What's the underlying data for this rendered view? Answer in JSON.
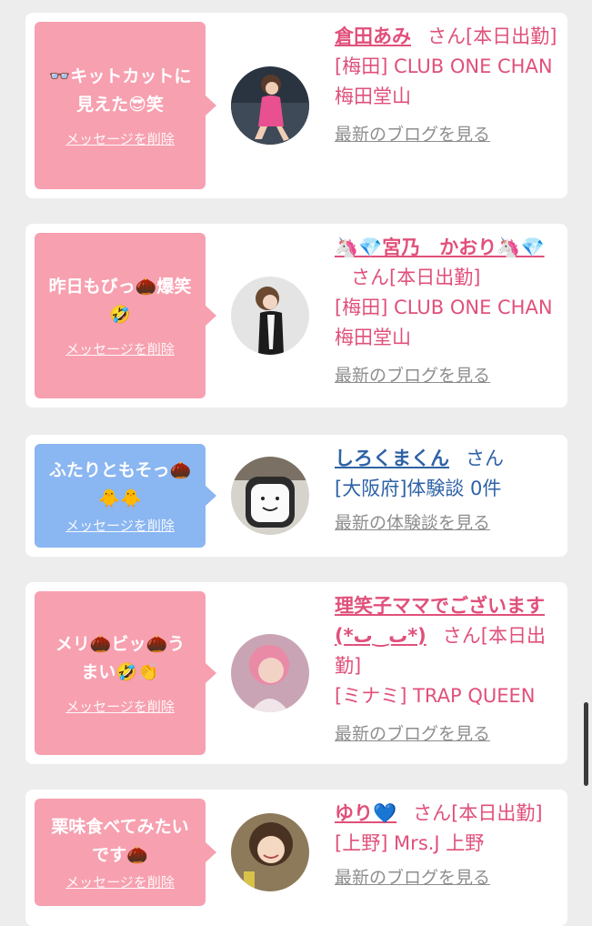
{
  "cards": [
    {
      "message": "👓キットカットに\n見えた😎笑",
      "delete_label": "メッセージを削除",
      "name": "倉田あみ",
      "suffix": "さん[本日出勤]",
      "detail": "[梅田] CLUB ONE CHAN 梅田堂山",
      "link": "最新のブログを見る",
      "bubble_color": "#f7a0b0",
      "avatar": "woman-pink-dress-avatar"
    },
    {
      "message": "昨日もびっ🌰爆笑\n🤣",
      "delete_label": "メッセージを削除",
      "name": "🦄💎宮乃　かおり🦄💎",
      "suffix": "さん[本日出勤]",
      "detail": "[梅田] CLUB ONE CHAN 梅田堂山",
      "link": "最新のブログを見る",
      "bubble_color": "#f7a0b0",
      "avatar": "woman-black-dress-avatar"
    },
    {
      "message": "ふたりともそっ🌰\n🐥🐥",
      "delete_label": "メッセージを削除",
      "name": "しろくまくん",
      "suffix": "さん",
      "detail": "[大阪府]体験談 0件",
      "link": "最新の体験談を見る",
      "bubble_color": "#8ab6f1",
      "avatar": "toast-character-avatar"
    },
    {
      "message": "メリ🌰ビッ🌰う\nまい🤣👏",
      "delete_label": "メッセージを削除",
      "name": "理笑子ママでございます(*ٮ‿ٮ*)",
      "suffix": "さん[本日出勤]",
      "detail": "[ミナミ] TRAP QUEEN",
      "link": "最新のブログを見る",
      "bubble_color": "#f7a0b0",
      "avatar": "woman-pink-hair-avatar"
    },
    {
      "message": "栗味食べてみたい\nです🌰",
      "delete_label": "メッセージを削除",
      "name": "ゆり💙",
      "suffix": "さん[本日出勤]",
      "detail": "[上野] Mrs.J 上野",
      "link": "最新のブログを見る",
      "bubble_color": "#f7a0b0",
      "avatar": "woman-smiling-avatar"
    }
  ]
}
